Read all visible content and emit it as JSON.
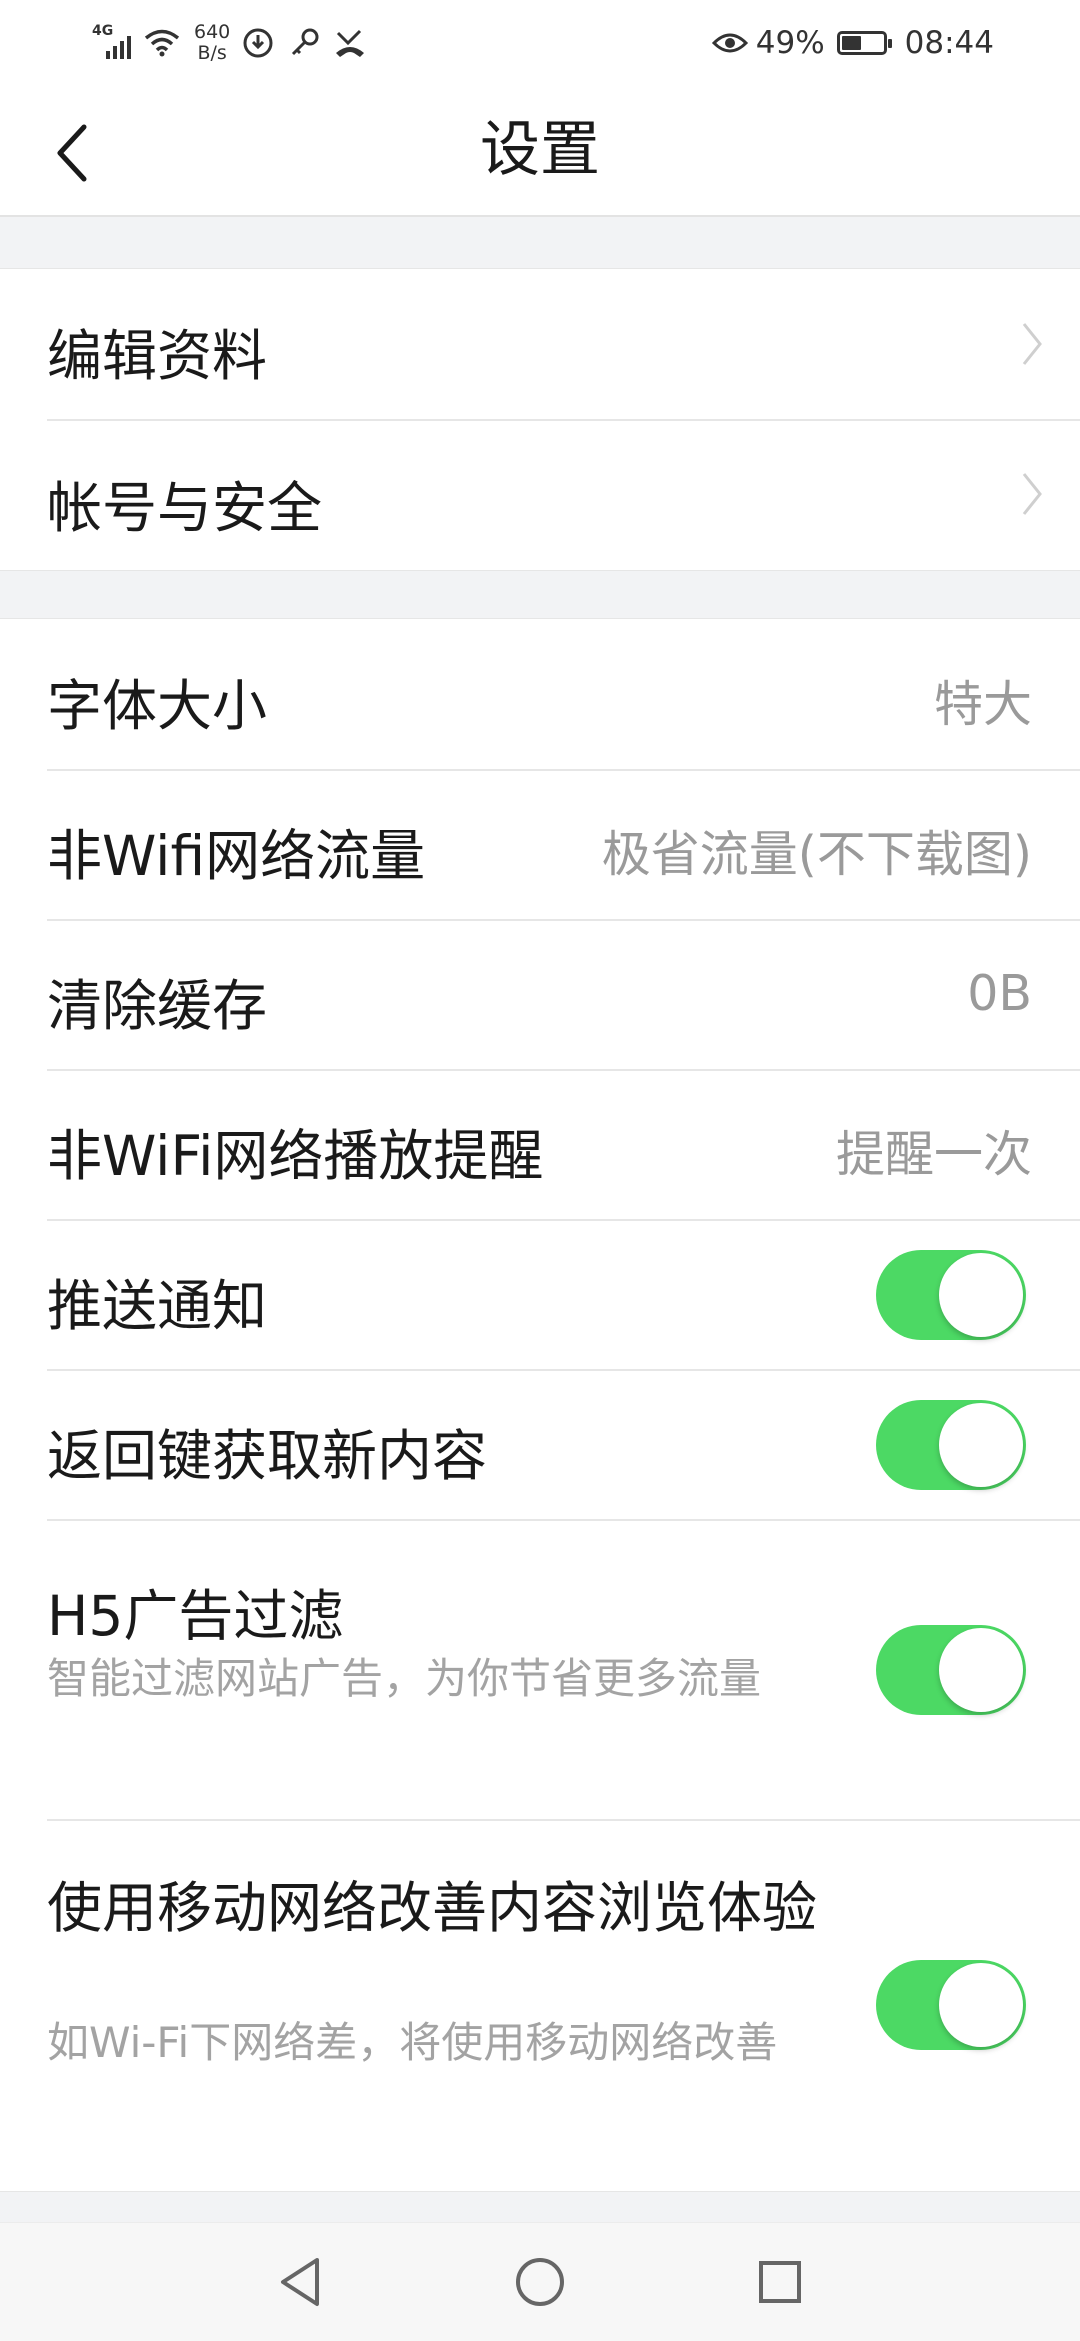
{
  "status_bar": {
    "network": "4G",
    "speed_value": "640",
    "speed_unit": "B/s",
    "battery_percent": "49%",
    "battery_level": 0.49,
    "time": "08:44",
    "icons": [
      "signal-icon",
      "wifi-icon",
      "data-saver-icon",
      "key-icon",
      "missed-call-icon",
      "eye-comfort-icon",
      "battery-icon"
    ]
  },
  "header": {
    "title": "设置"
  },
  "group1": [
    {
      "label": "编辑资料"
    },
    {
      "label": "帐号与安全"
    }
  ],
  "group2": {
    "font_size": {
      "label": "字体大小",
      "value": "特大"
    },
    "mobile_data": {
      "label": "非Wifi网络流量",
      "value": "极省流量(不下载图)"
    },
    "clear_cache": {
      "label": "清除缓存",
      "value": "0B"
    },
    "play_reminder": {
      "label": "非WiFi网络播放提醒",
      "value": "提醒一次"
    },
    "push": {
      "label": "推送通知",
      "on": true
    },
    "back_refresh": {
      "label": "返回键获取新内容",
      "on": true
    },
    "ad_filter": {
      "label": "H5广告过滤",
      "sub": "智能过滤网站广告，为你节省更多流量",
      "on": true
    },
    "mobile_assist": {
      "label": "使用移动网络改善内容浏览体验",
      "sub": "如Wi-Fi下网络差，将使用移动网络改善",
      "on": true
    }
  },
  "colors": {
    "toggle_on": "#4cd964",
    "background": "#f2f3f5"
  }
}
